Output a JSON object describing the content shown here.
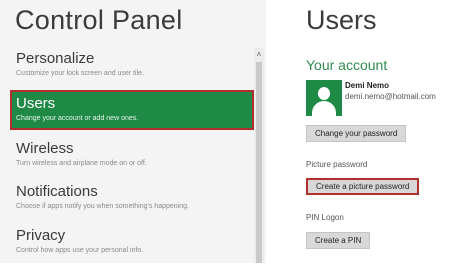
{
  "left": {
    "title": "Control Panel",
    "nav": [
      {
        "label": "Personalize",
        "desc": "Customize your lock screen and user tile."
      },
      {
        "label": "Users",
        "desc": "Change your account or add new ones."
      },
      {
        "label": "Wireless",
        "desc": "Turn wireless and airplane mode on or off."
      },
      {
        "label": "Notifications",
        "desc": "Choose if apps notify you when something's happening."
      },
      {
        "label": "Privacy",
        "desc": "Control how apps use your personal info."
      }
    ],
    "scroll_up_glyph": "˄"
  },
  "right": {
    "title": "Users",
    "account_heading": "Your account",
    "user": {
      "name": "Demi Nemo",
      "email": "demi.nemo@hotmail.com",
      "avatar_icon": "user-avatar-icon"
    },
    "change_password_label": "Change your password",
    "picture_password_label": "Picture password",
    "create_picture_password_label": "Create a picture password",
    "pin_logon_label": "PIN Logon",
    "create_pin_label": "Create a PIN"
  },
  "colors": {
    "accent": "#1e8a46",
    "highlight_border": "#b03030",
    "heading_green": "#2e8b4f"
  }
}
